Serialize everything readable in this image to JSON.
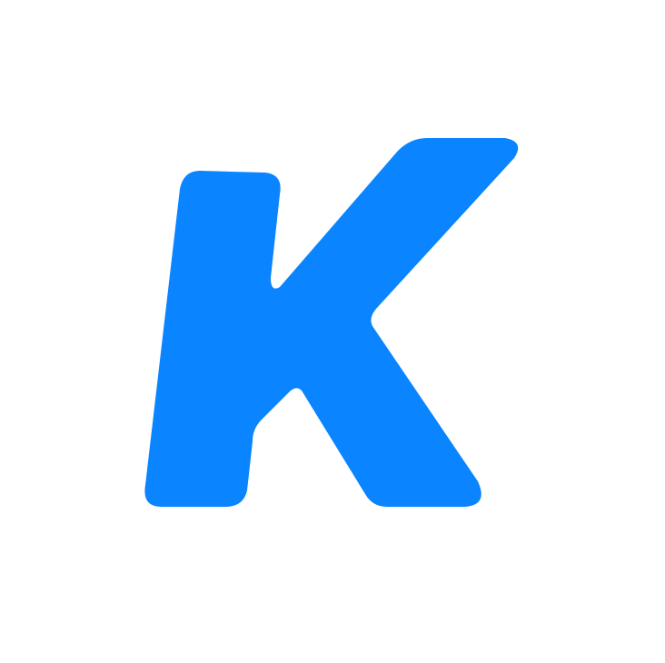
{
  "logo": {
    "icon": "k-letter-logo-icon",
    "letter": "K",
    "brand_color": "#0A84FF",
    "background_color": "#FFFFFF"
  }
}
